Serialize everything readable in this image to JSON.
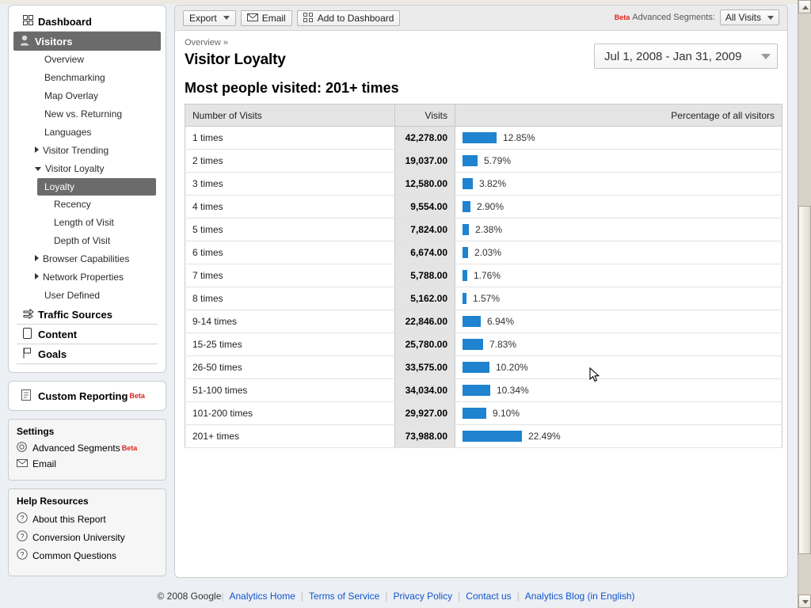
{
  "sidebar": {
    "nav": [
      {
        "label": "Dashboard",
        "icon": "grid-icon",
        "level": "top",
        "selected": false
      },
      {
        "label": "Visitors",
        "icon": "person-icon",
        "level": "top",
        "selected": true
      },
      {
        "label": "Overview",
        "level": "sub"
      },
      {
        "label": "Benchmarking",
        "level": "sub"
      },
      {
        "label": "Map Overlay",
        "level": "sub"
      },
      {
        "label": "New vs. Returning",
        "level": "sub"
      },
      {
        "label": "Languages",
        "level": "sub"
      },
      {
        "label": "Visitor Trending",
        "level": "sub",
        "expander": "closed"
      },
      {
        "label": "Visitor Loyalty",
        "level": "sub",
        "expander": "open"
      },
      {
        "label": "Loyalty",
        "level": "subsub",
        "active": true
      },
      {
        "label": "Recency",
        "level": "subsub"
      },
      {
        "label": "Length of Visit",
        "level": "subsub"
      },
      {
        "label": "Depth of Visit",
        "level": "subsub"
      },
      {
        "label": "Browser Capabilities",
        "level": "sub",
        "expander": "closed"
      },
      {
        "label": "Network Properties",
        "level": "sub",
        "expander": "closed"
      },
      {
        "label": "User Defined",
        "level": "sub"
      },
      {
        "label": "Traffic Sources",
        "icon": "arrows-icon",
        "level": "top",
        "selected": false
      },
      {
        "label": "Content",
        "icon": "page-icon",
        "level": "top",
        "selected": false
      },
      {
        "label": "Goals",
        "icon": "flag-icon",
        "level": "top",
        "selected": false
      }
    ],
    "custom_reporting": {
      "label": "Custom Reporting",
      "badge": "Beta",
      "icon": "report-icon"
    },
    "settings": {
      "title": "Settings",
      "items": [
        {
          "label": "Advanced Segments",
          "badge": "Beta",
          "icon": "target-icon"
        },
        {
          "label": "Email",
          "badge": "",
          "icon": "envelope-icon"
        }
      ]
    },
    "help": {
      "title": "Help Resources",
      "items": [
        {
          "label": "About this Report",
          "icon": "question-icon"
        },
        {
          "label": "Conversion University",
          "icon": "question-icon"
        },
        {
          "label": "Common Questions",
          "icon": "question-icon"
        }
      ]
    }
  },
  "toolbar": {
    "export_label": "Export",
    "email_label": "Email",
    "add_dashboard_label": "Add to Dashboard",
    "segments_badge": "Beta",
    "segments_label": "Advanced Segments:",
    "segments_value": "All Visits"
  },
  "content": {
    "breadcrumb": "Overview »",
    "title": "Visitor Loyalty",
    "date_range": "Jul 1, 2008 - Jan 31, 2009",
    "subtitle": "Most people visited: 201+ times"
  },
  "chart_data": {
    "type": "bar",
    "title": "Most people visited: 201+ times",
    "xlabel": "Number of Visits",
    "ylabel": "Percentage of all visitors",
    "columns": [
      "Number of Visits",
      "Visits",
      "Percentage of all visitors"
    ],
    "accent_color": "#1f83d0",
    "max_percent": 22.49,
    "categories": [
      "1 times",
      "2 times",
      "3 times",
      "4 times",
      "5 times",
      "6 times",
      "7 times",
      "8 times",
      "9-14 times",
      "15-25 times",
      "26-50 times",
      "51-100 times",
      "101-200 times",
      "201+ times"
    ],
    "values": [
      42278,
      19037,
      12580,
      9554,
      7824,
      6674,
      5788,
      5162,
      22846,
      25780,
      33575,
      34034,
      29927,
      73988
    ],
    "percentages": [
      12.85,
      5.79,
      3.82,
      2.9,
      2.38,
      2.03,
      1.76,
      1.57,
      6.94,
      7.83,
      10.2,
      10.34,
      9.1,
      22.49
    ],
    "rows": [
      {
        "label": "1 times",
        "visits": "42,278.00",
        "pct": 12.85,
        "pct_label": "12.85%"
      },
      {
        "label": "2 times",
        "visits": "19,037.00",
        "pct": 5.79,
        "pct_label": "5.79%"
      },
      {
        "label": "3 times",
        "visits": "12,580.00",
        "pct": 3.82,
        "pct_label": "3.82%"
      },
      {
        "label": "4 times",
        "visits": "9,554.00",
        "pct": 2.9,
        "pct_label": "2.90%"
      },
      {
        "label": "5 times",
        "visits": "7,824.00",
        "pct": 2.38,
        "pct_label": "2.38%"
      },
      {
        "label": "6 times",
        "visits": "6,674.00",
        "pct": 2.03,
        "pct_label": "2.03%"
      },
      {
        "label": "7 times",
        "visits": "5,788.00",
        "pct": 1.76,
        "pct_label": "1.76%"
      },
      {
        "label": "8 times",
        "visits": "5,162.00",
        "pct": 1.57,
        "pct_label": "1.57%"
      },
      {
        "label": "9-14 times",
        "visits": "22,846.00",
        "pct": 6.94,
        "pct_label": "6.94%"
      },
      {
        "label": "15-25 times",
        "visits": "25,780.00",
        "pct": 7.83,
        "pct_label": "7.83%"
      },
      {
        "label": "26-50 times",
        "visits": "33,575.00",
        "pct": 10.2,
        "pct_label": "10.20%"
      },
      {
        "label": "51-100 times",
        "visits": "34,034.00",
        "pct": 10.34,
        "pct_label": "10.34%"
      },
      {
        "label": "101-200 times",
        "visits": "29,927.00",
        "pct": 9.1,
        "pct_label": "9.10%"
      },
      {
        "label": "201+ times",
        "visits": "73,988.00",
        "pct": 22.49,
        "pct_label": "22.49%"
      }
    ]
  },
  "footer": {
    "copyright": "© 2008 Google",
    "links": [
      "Analytics Home",
      "Terms of Service",
      "Privacy Policy",
      "Contact us",
      "Analytics Blog (in English)"
    ]
  }
}
